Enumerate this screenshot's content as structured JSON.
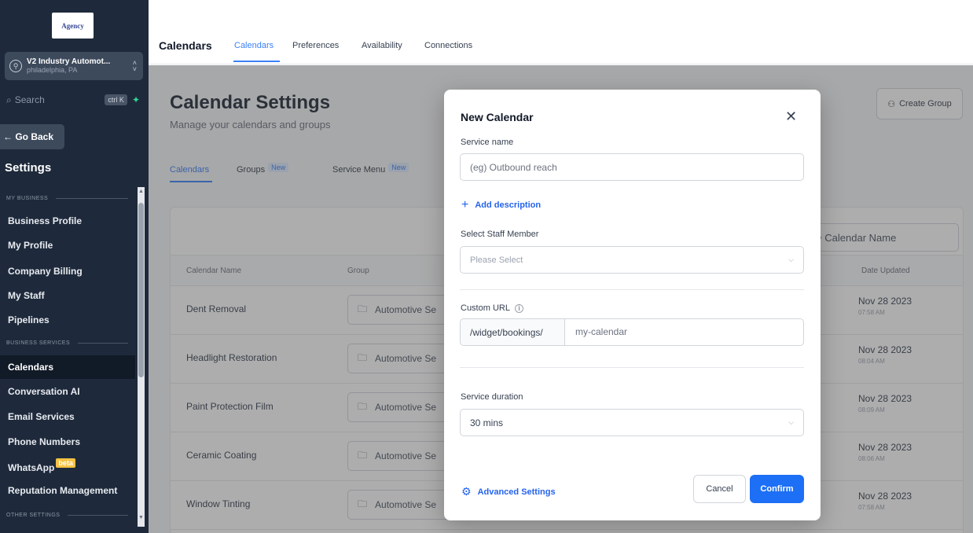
{
  "sidebar": {
    "logo_text": "Agency",
    "account": {
      "name": "V2 Industry Automot...",
      "location": "philadelphia, PA"
    },
    "search": {
      "label": "Search",
      "shortcut": "ctrl K"
    },
    "go_back": "← Go Back",
    "title": "Settings",
    "sections": {
      "my_business": "MY BUSINESS",
      "business_services": "BUSINESS SERVICES",
      "other_settings": "OTHER SETTINGS"
    },
    "items": {
      "business_profile": "Business Profile",
      "my_profile": "My Profile",
      "company_billing": "Company Billing",
      "my_staff": "My Staff",
      "pipelines": "Pipelines",
      "calendars": "Calendars",
      "conversation_ai": "Conversation AI",
      "email_services": "Email Services",
      "phone_numbers": "Phone Numbers",
      "whatsapp": "WhatsApp",
      "whatsapp_badge": "beta",
      "reputation_management": "Reputation Management"
    }
  },
  "topnav": {
    "title": "Calendars",
    "tabs": [
      "Calendars",
      "Preferences",
      "Availability",
      "Connections"
    ]
  },
  "main": {
    "title": "Calendar Settings",
    "subtitle": "Manage your calendars and groups",
    "create_group": "Create Group",
    "subtabs": {
      "calendars": "Calendars",
      "groups": "Groups",
      "service_menu": "Service Menu",
      "new_badge": "New"
    },
    "table_search_placeholder": "Calendar Name",
    "columns": {
      "name": "Calendar Name",
      "group": "Group",
      "date": "Date Updated"
    },
    "rows": [
      {
        "name": "Dent Removal",
        "group": "Automotive Se",
        "date": "Nov 28 2023",
        "time": "07:58 AM"
      },
      {
        "name": "Headlight Restoration",
        "group": "Automotive Se",
        "date": "Nov 28 2023",
        "time": "08:04 AM"
      },
      {
        "name": "Paint Protection Film",
        "group": "Automotive Se",
        "date": "Nov 28 2023",
        "time": "08:09 AM"
      },
      {
        "name": "Ceramic Coating",
        "group": "Automotive Se",
        "date": "Nov 28 2023",
        "time": "08:06 AM"
      },
      {
        "name": "Window Tinting",
        "group": "Automotive Se",
        "date": "Nov 28 2023",
        "time": "07:58 AM"
      }
    ]
  },
  "modal": {
    "title": "New Calendar",
    "service_name_label": "Service name",
    "service_name_placeholder": "(eg) Outbound reach",
    "add_description": "Add description",
    "staff_label": "Select Staff Member",
    "staff_placeholder": "Please Select",
    "custom_url_label": "Custom URL",
    "url_prefix": "/widget/bookings/",
    "url_value": "my-calendar",
    "duration_label": "Service duration",
    "duration_value": "30 mins",
    "advanced_settings": "Advanced Settings",
    "cancel": "Cancel",
    "confirm": "Confirm"
  },
  "colors": {
    "sidebar_bg": "#1e2a3b",
    "accent": "#1d6ff5",
    "beta_badge": "#f6c343"
  }
}
